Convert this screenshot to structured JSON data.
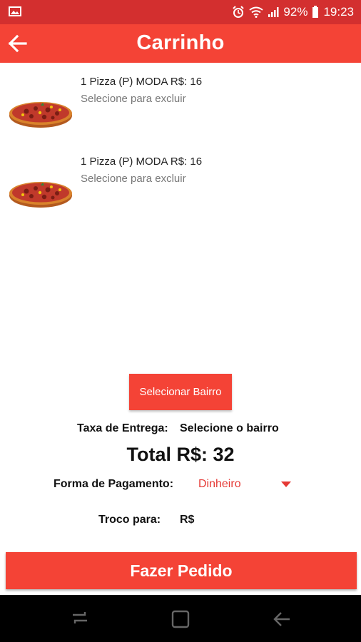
{
  "status_bar": {
    "battery": "92%",
    "time": "19:23",
    "icons": [
      "image-icon",
      "alarm-icon",
      "wifi-icon",
      "signal-icon",
      "battery-icon"
    ]
  },
  "app_bar": {
    "title": "Carrinho",
    "back_icon": "arrow-back-icon"
  },
  "cart": {
    "items": [
      {
        "title": "1 Pizza (P) MODA R$: 16",
        "subtitle": "Selecione para excluir",
        "image": "pizza-image"
      },
      {
        "title": "1 Pizza (P) MODA R$: 16",
        "subtitle": "Selecione para excluir",
        "image": "pizza-image"
      }
    ]
  },
  "summary": {
    "select_bairro_label": "Selecionar Bairro",
    "delivery_fee_label": "Taxa de Entrega:",
    "delivery_fee_value": "Selecione o bairro",
    "total": "Total R$: 32",
    "payment_label": "Forma de Pagamento:",
    "payment_value": "Dinheiro",
    "change_label": "Troco para:",
    "change_value": "R$"
  },
  "actions": {
    "place_order_label": "Fazer Pedido"
  },
  "nav": {
    "icons": [
      "recent-apps-icon",
      "home-icon",
      "back-icon"
    ]
  },
  "colors": {
    "status_bar": "#d32f2f",
    "primary": "#f44336",
    "accent_text": "#e53935"
  }
}
